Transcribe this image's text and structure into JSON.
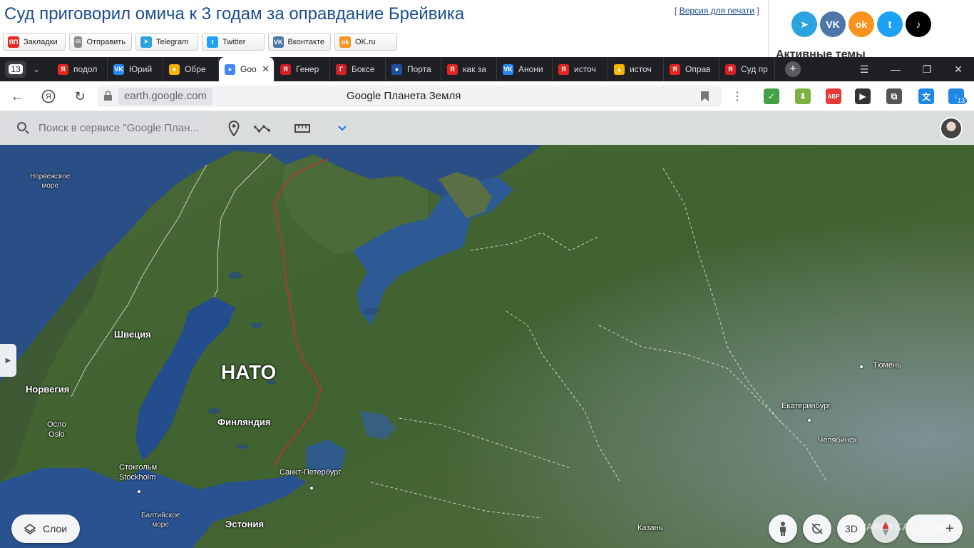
{
  "article": {
    "title": "Суд приговорил омича к 3 годам за оправдание Брейвика",
    "print_open": "[",
    "print_link": "Версия для печати",
    "print_close": "]"
  },
  "share_buttons": [
    {
      "label": "Закладки",
      "icon": "yandex-bookmarks-icon",
      "color": "#e52620",
      "glyph": "ЯП"
    },
    {
      "label": "Отправить",
      "icon": "mail-icon",
      "color": "#888888",
      "glyph": "✉"
    },
    {
      "label": "Telegram",
      "icon": "telegram-icon",
      "color": "#2aa3df",
      "glyph": "➤"
    },
    {
      "label": "Twitter",
      "icon": "twitter-icon",
      "color": "#1da1f2",
      "glyph": "t"
    },
    {
      "label": "Вконтакте",
      "icon": "vk-icon",
      "color": "#4a76a8",
      "glyph": "VK"
    },
    {
      "label": "OK.ru",
      "icon": "odnoklassniki-icon",
      "color": "#f7931e",
      "glyph": "ok"
    }
  ],
  "social_circles": [
    {
      "name": "telegram",
      "color": "#2aa3df",
      "glyph": "➤"
    },
    {
      "name": "vk",
      "color": "#4a76a8",
      "glyph": "VK"
    },
    {
      "name": "odnoklassniki",
      "color": "#f7931e",
      "glyph": "ok"
    },
    {
      "name": "twitter",
      "color": "#1da1f2",
      "glyph": "t"
    },
    {
      "name": "tiktok",
      "color": "#000000",
      "glyph": "♪"
    }
  ],
  "side": {
    "active_themes": "Активные темы"
  },
  "browser": {
    "tab_count": "13",
    "tabs": [
      {
        "title": "подол",
        "favicon_color": "#e52620",
        "glyph": "Я"
      },
      {
        "title": "Юрий",
        "favicon_color": "#2787f5",
        "glyph": "VK"
      },
      {
        "title": "Обре",
        "favicon_color": "#f7b500",
        "glyph": "●"
      },
      {
        "title": "Goo",
        "favicon_color": "#4285f4",
        "glyph": "●",
        "active": true
      },
      {
        "title": "Генер",
        "favicon_color": "#d31f26",
        "glyph": "Я"
      },
      {
        "title": "Боксе",
        "favicon_color": "#d31f26",
        "glyph": "Г"
      },
      {
        "title": "Порта",
        "favicon_color": "#1c4fa0",
        "glyph": "●"
      },
      {
        "title": "как за",
        "favicon_color": "#e52620",
        "glyph": "Я"
      },
      {
        "title": "Анони",
        "favicon_color": "#2787f5",
        "glyph": "VK"
      },
      {
        "title": "источ",
        "favicon_color": "#e52620",
        "glyph": "Я"
      },
      {
        "title": "источ",
        "favicon_color": "#f7b500",
        "glyph": "▲"
      },
      {
        "title": "Оправ",
        "favicon_color": "#e52620",
        "glyph": "Я"
      },
      {
        "title": "Суд пр",
        "favicon_color": "#d31f26",
        "glyph": "Я"
      }
    ],
    "url": "earth.google.com",
    "page_title": "Google Планета Земля",
    "extensions": [
      {
        "name": "adguard-icon",
        "color": "#43a047",
        "glyph": "✓"
      },
      {
        "name": "download-helper-icon",
        "color": "#7cb342",
        "glyph": "⬇"
      },
      {
        "name": "adblock-icon",
        "color": "#e53935",
        "glyph": "ABP"
      },
      {
        "name": "video-icon",
        "color": "#333333",
        "glyph": "▶"
      },
      {
        "name": "extensions-icon",
        "color": "#555555",
        "glyph": "⧉"
      },
      {
        "name": "translate-icon",
        "color": "#1e88e5",
        "glyph": "文"
      },
      {
        "name": "downloads-icon",
        "color": "#1e88e5",
        "glyph": "↓"
      }
    ],
    "downloads_badge": "13"
  },
  "earth": {
    "search_placeholder": "Поиск в сервисе \"Google План...",
    "layers_label": "Слои",
    "btn_3d": "3D",
    "watermark": "YAPLAKAL.COM",
    "labels": {
      "norwegian_sea": "Норвежское\nморе",
      "sweden": "Швеция",
      "norway": "Норвегия",
      "nato": "НАТО",
      "finland": "Финляндия",
      "oslo": "Осло\nOslo",
      "stockholm": "Стокгольм\nStockholm",
      "baltic_sea": "Балтийское\nморе",
      "estonia": "Эстония",
      "saint_petersburg": "Санкт-Петербург",
      "yekaterinburg": "Екатеринбург",
      "chelyabinsk": "Челябинск",
      "tyumen": "Тюмень",
      "kazan": "Казань"
    }
  }
}
